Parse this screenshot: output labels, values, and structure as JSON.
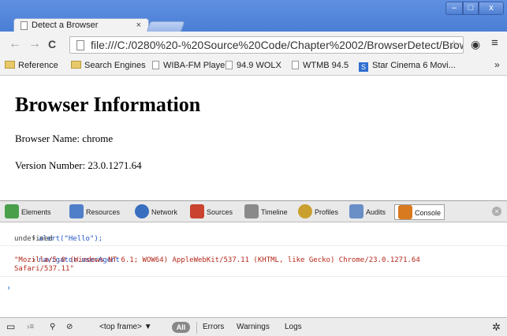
{
  "window": {
    "tab_title": "Detect a Browser",
    "tab_close": "×",
    "controls": {
      "minimize": "–",
      "maximize": "□",
      "close": "x"
    }
  },
  "toolbar": {
    "back": "←",
    "forward": "→",
    "reload": "C",
    "url": "file:///C:/0280%20-%20Source%20Code/Chapter%2002/BrowserDetect/Brows",
    "star": "☆",
    "extension": "◉",
    "menu": "≡"
  },
  "bookmarks": {
    "items": [
      {
        "label": "Reference",
        "kind": "folder"
      },
      {
        "label": "Search Engines",
        "kind": "folder"
      },
      {
        "label": "WIBA-FM Player",
        "kind": "page"
      },
      {
        "label": "94.9 WOLX",
        "kind": "page"
      },
      {
        "label": "WTMB 94.5",
        "kind": "page"
      },
      {
        "label": "Star Cinema 6 Movi...",
        "kind": "site"
      }
    ],
    "more": "»"
  },
  "page": {
    "heading": "Browser Information",
    "browser_name_line": "Browser Name: chrome",
    "version_line": "Version Number: 23.0.1271.64"
  },
  "devtools": {
    "tabs": [
      {
        "label": "Elements",
        "color": "#4aa04a"
      },
      {
        "label": "Resources",
        "color": "#4f7fc9"
      },
      {
        "label": "Network",
        "color": "#3a6fbf"
      },
      {
        "label": "Sources",
        "color": "#c9432f"
      },
      {
        "label": "Timeline",
        "color": "#8a8a8a"
      },
      {
        "label": "Profiles",
        "color": "#c9a02f"
      },
      {
        "label": "Audits",
        "color": "#6a8ec6"
      },
      {
        "label": "Console",
        "color": "#d87a1f"
      }
    ],
    "close": "×",
    "console": {
      "lines": [
        {
          "text": "alert(\"Hello\");"
        },
        {
          "text": "undefined"
        },
        {
          "text": "navigator.userAgent"
        },
        {
          "text": "\"Mozilla/5.0 (Windows NT 6.1; WOW64) AppleWebKit/537.11 (KHTML, like Gecko) Chrome/23.0.1271.64"
        },
        {
          "text": "Safari/537.11\""
        }
      ],
      "prompt": "›",
      "arrow": "›"
    },
    "status": {
      "frame": "<top frame> ▼",
      "all": "All",
      "errors": "Errors",
      "warnings": "Warnings",
      "logs": "Logs",
      "settings": "✲"
    }
  }
}
